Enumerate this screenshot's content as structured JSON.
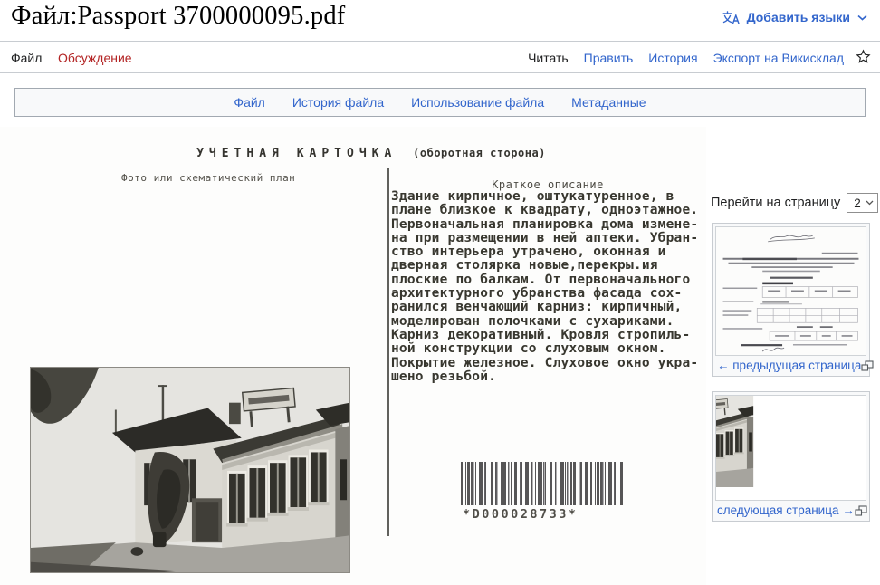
{
  "header": {
    "title": "Файл:Passport 3700000095.pdf",
    "add_languages": "Добавить языки"
  },
  "tabs": {
    "file": "Файл",
    "talk": "Обсуждение",
    "read": "Читать",
    "edit": "Править",
    "history": "История",
    "export": "Экспорт на Викисклад"
  },
  "filetoc": {
    "links": [
      "Файл",
      "История файла",
      "Использование файла",
      "Метаданные"
    ]
  },
  "scan": {
    "card_title": "УЧЕТНАЯ КАРТОЧКА",
    "card_title_suffix": "(оборотная сторона)",
    "photo_label": "Фото или схематический план",
    "desc_label": "Краткое описание",
    "desc_lines": [
      "Здание кирпичное, оштукатуренное, в",
      "плане близкое к квадрату, одноэтажное.",
      "Первоначальная планировка дома измене-",
      "на при размещении в ней аптеки. Убран-",
      "ство интерьера утрачено, оконная и",
      "дверная столярка новые,перекры.ия",
      "плоские по балкам. От первоначального",
      "архитектурного убранства фасада сох-",
      "ранился венчающий карниз: кирпичный,",
      "моделирован полочками с сухариками.",
      "Карниз декоративный. Кровля стропиль-",
      "ной конструкции со слуховым окном.",
      "Покрытие железное. Слуховое окно укра-",
      "шено резьбой."
    ],
    "barcode_text": "*D000028733*"
  },
  "sidebar": {
    "goto_label": "Перейти на страницу",
    "page_value": "2",
    "prev_label": "← предыдущая страница",
    "next_label": "следующая страница →"
  },
  "colors": {
    "link": "#3366cc",
    "redlink": "#b32424",
    "active_tab_underline": "#202122",
    "box_border": "#a2a9b1"
  }
}
